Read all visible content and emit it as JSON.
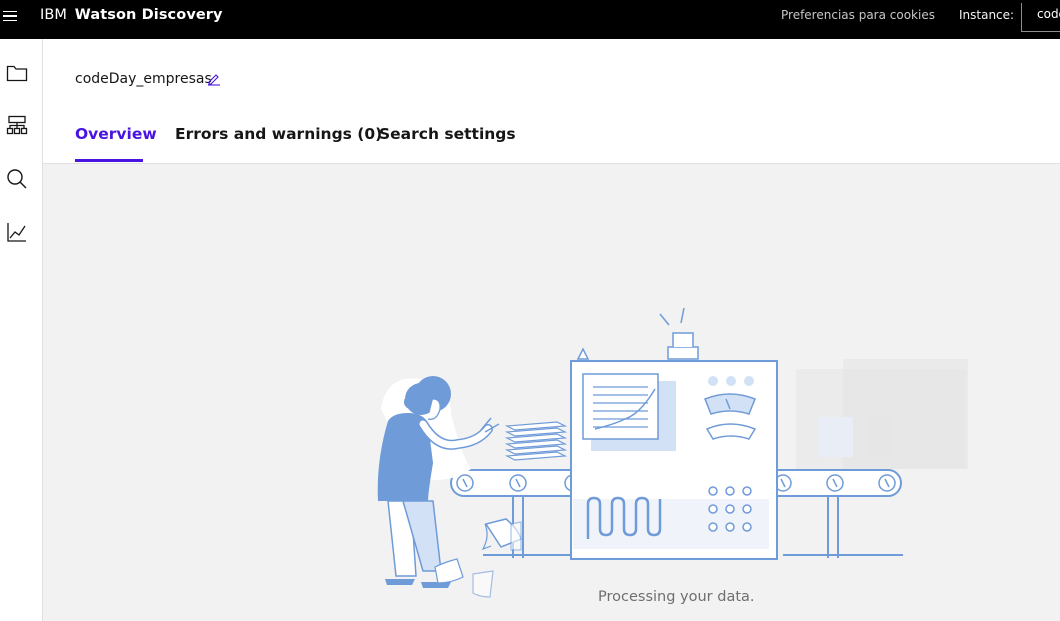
{
  "header": {
    "ibm": "IBM",
    "product": "Watson Discovery",
    "cookie_link": "Preferencias para cookies",
    "instance_label": "Instance:",
    "instance_value": "codeDay"
  },
  "sidebar": {
    "items": [
      {
        "icon": "folder-icon"
      },
      {
        "icon": "hierarchy-icon"
      },
      {
        "icon": "search-icon"
      },
      {
        "icon": "chart-line-icon"
      }
    ]
  },
  "project": {
    "title": "codeDay_empresas"
  },
  "tabs": [
    {
      "label": "Overview",
      "active": true
    },
    {
      "label": "Errors and warnings (0)",
      "active": false
    },
    {
      "label": "Search settings",
      "active": false
    }
  ],
  "status": {
    "message": "Processing your data."
  },
  "colors": {
    "accent": "#4914e0",
    "illustration_blue": "#6f9bd9",
    "illustration_light": "#d2e1f5"
  }
}
